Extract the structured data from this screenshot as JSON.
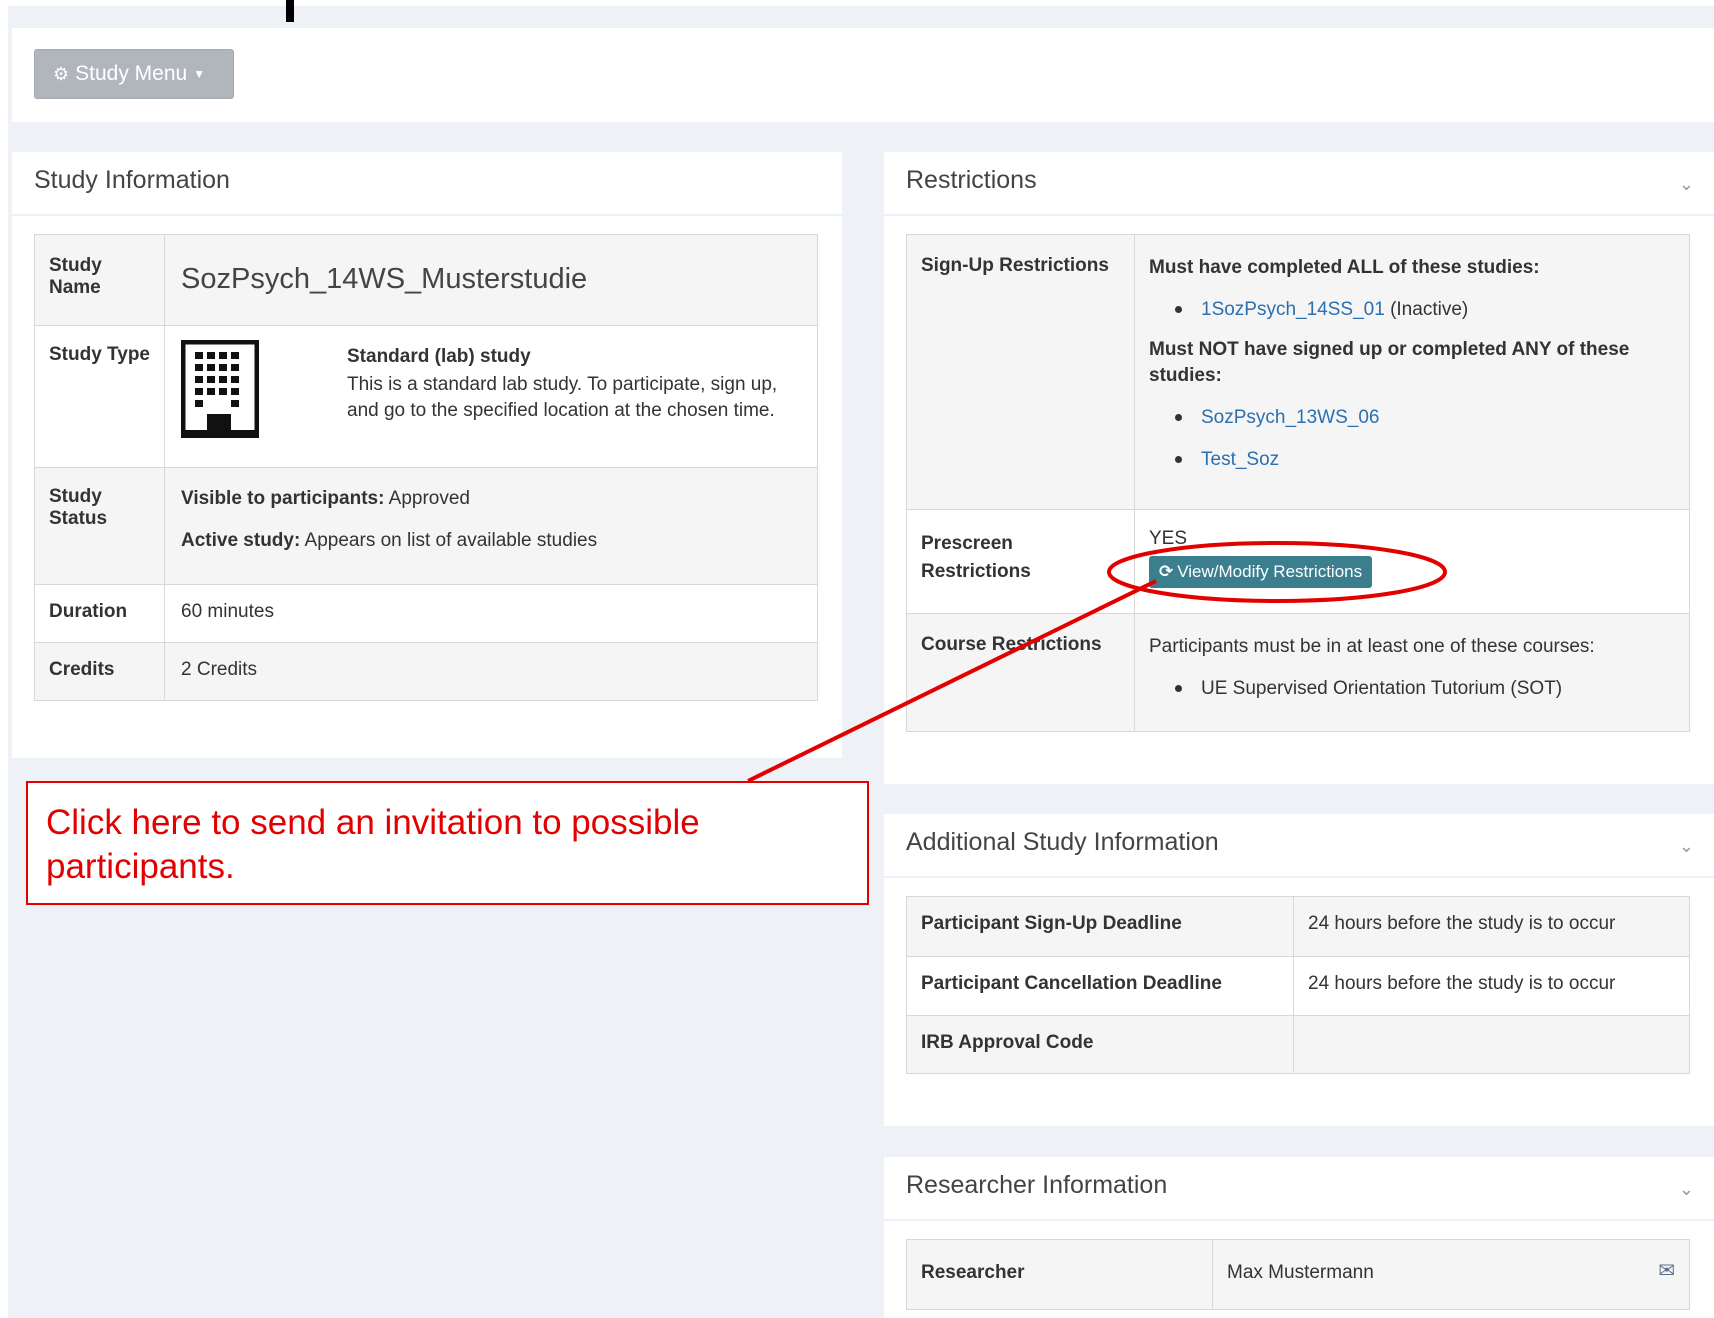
{
  "menu": {
    "study_menu_label": "Study Menu"
  },
  "study_info": {
    "title": "Study Information",
    "name_label": "Study Name",
    "name_value": "SozPsych_14WS_Musterstudie",
    "type_label": "Study Type",
    "type_title": "Standard (lab) study",
    "type_desc": "This is a standard lab study. To participate, sign up, and go to the specified location at the chosen time.",
    "status_label": "Study Status",
    "visible_label": "Visible to participants:",
    "visible_value": "Approved",
    "active_label": "Active study:",
    "active_value": "Appears on list of available studies",
    "duration_label": "Duration",
    "duration_value": "60 minutes",
    "credits_label": "Credits",
    "credits_value": "2 Credits"
  },
  "restrictions": {
    "title": "Restrictions",
    "signup_label": "Sign-Up Restrictions",
    "must_completed": "Must have completed ALL of these studies:",
    "completed_studies": [
      {
        "name": "1SozPsych_14SS_01",
        "note": "(Inactive)"
      }
    ],
    "must_not": "Must NOT have signed up or completed ANY of these studies:",
    "not_studies": [
      "SozPsych_13WS_06",
      "Test_Soz"
    ],
    "prescreen_label": "Prescreen Restrictions",
    "prescreen_value": "YES",
    "view_modify_label": "View/Modify Restrictions",
    "course_label": "Course Restrictions",
    "course_intro": "Participants must be in at least one of these courses:",
    "courses": [
      "UE Supervised Orientation Tutorium (SOT)"
    ]
  },
  "additional": {
    "title": "Additional Study Information",
    "rows": [
      {
        "label": "Participant Sign-Up Deadline",
        "value": "24 hours before the study is to occur"
      },
      {
        "label": "Participant Cancellation Deadline",
        "value": "24 hours before the study is to occur"
      },
      {
        "label": "IRB Approval Code",
        "value": ""
      }
    ]
  },
  "researcher": {
    "title": "Researcher Information",
    "label": "Researcher",
    "value": "Max Mustermann"
  },
  "callout": {
    "text": "Click here to send an invitation to possible participants."
  },
  "colors": {
    "annotation": "#e30000",
    "link": "#2a6fb0",
    "button": "#3b7f8f"
  }
}
